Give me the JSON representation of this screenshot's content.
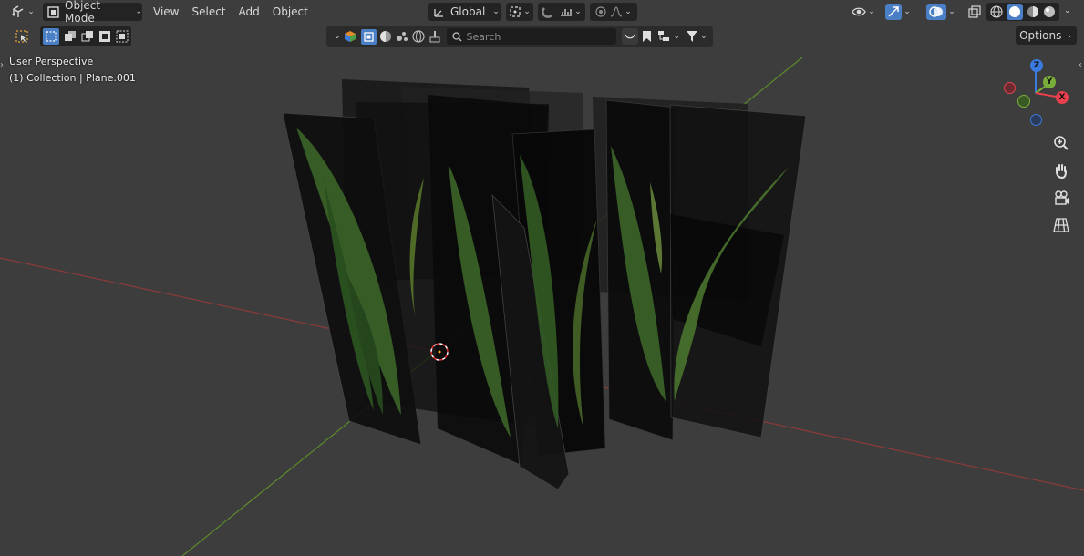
{
  "header": {
    "editor_type_icon": "view3d-icon",
    "mode_label": "Object Mode",
    "menus": [
      "View",
      "Select",
      "Add",
      "Object"
    ],
    "transform_orientation": "Global",
    "options_label": "Options"
  },
  "toolbar": {
    "search_placeholder": "Search"
  },
  "overlay": {
    "view_name": "User Perspective",
    "collection_info": "(1) Collection | Plane.001"
  },
  "gizmo": {
    "x_label": "X",
    "y_label": "Y",
    "z_label": "Z",
    "x_color": "#e8404d",
    "y_color": "#7aae3a",
    "z_color": "#3a7be0"
  },
  "colors": {
    "background": "#3d3d3d",
    "header_button": "#232323",
    "accent_blue": "#4a7fc6",
    "x_axis_line": "#a13a3a",
    "y_axis_line": "#5d8c2a"
  }
}
